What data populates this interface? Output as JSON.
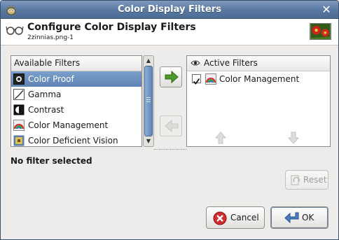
{
  "window": {
    "title": "Color Display Filters"
  },
  "header": {
    "title": "Configure Color Display Filters",
    "subtitle": "2zinnias.png-1"
  },
  "available": {
    "heading": "Available Filters",
    "items": [
      {
        "label": "Color Proof",
        "icon": "color-proof-icon",
        "selected": true
      },
      {
        "label": "Gamma",
        "icon": "gamma-icon",
        "selected": false
      },
      {
        "label": "Contrast",
        "icon": "contrast-icon",
        "selected": false
      },
      {
        "label": "Color Management",
        "icon": "color-management-icon",
        "selected": false
      },
      {
        "label": "Color Deficient Vision",
        "icon": "color-deficient-vision-icon",
        "selected": false
      }
    ]
  },
  "active": {
    "heading": "Active Filters",
    "items": [
      {
        "label": "Color Management",
        "checked": true
      }
    ]
  },
  "status": "No filter selected",
  "buttons": {
    "reset": "Reset",
    "cancel": "Cancel",
    "ok": "OK"
  },
  "colors": {
    "titlebar": "#5878a2",
    "selection": "#6a8fbe",
    "add_arrow": "#3f8f1e",
    "cancel_icon": "#cc2b2b",
    "ok_icon": "#3a6bb0"
  }
}
